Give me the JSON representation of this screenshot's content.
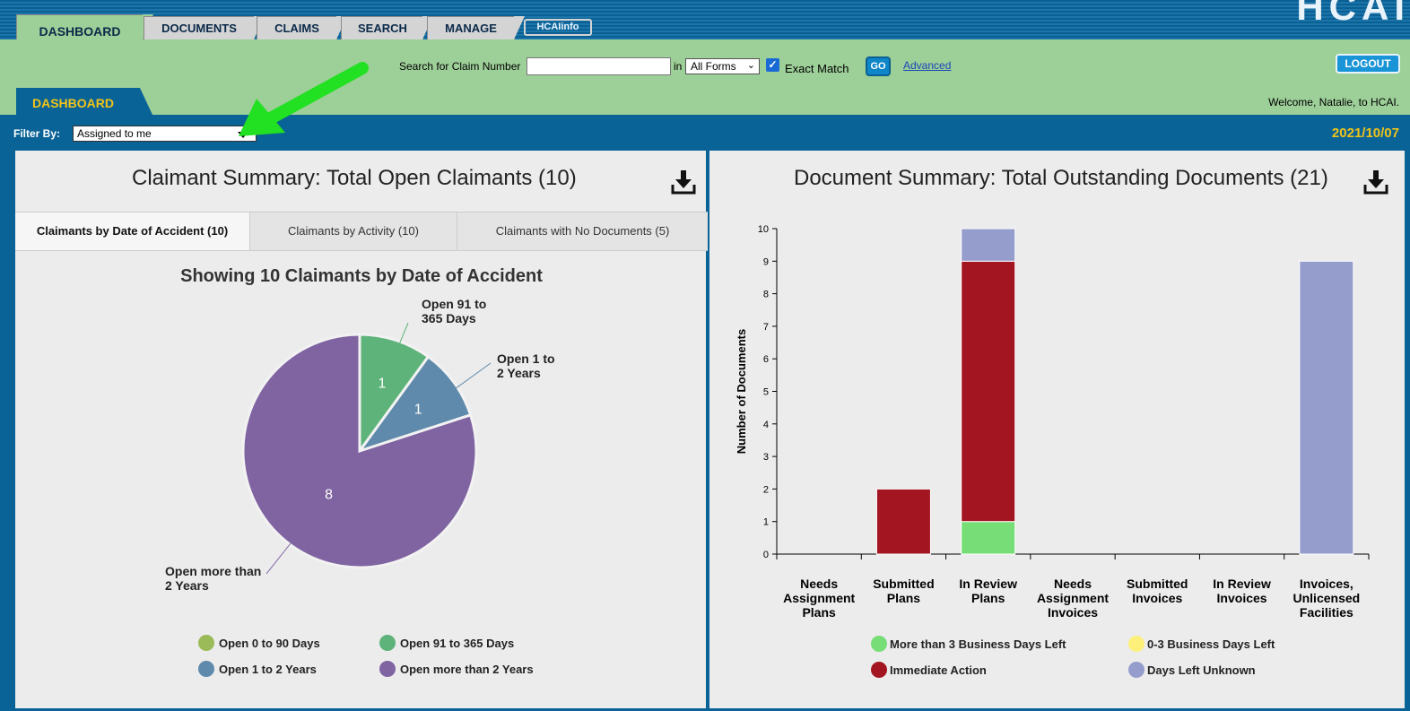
{
  "nav": {
    "tabs": [
      "DASHBOARD",
      "DOCUMENTS",
      "CLAIMS",
      "SEARCH",
      "MANAGE"
    ],
    "hcainfo": "HCAIinfo",
    "logo_text": "HCAI"
  },
  "search": {
    "label": "Search for Claim Number",
    "value": "",
    "in_label": "in",
    "forms_selected": "All Forms",
    "exact_match_label": "Exact Match",
    "exact_match_checked": true,
    "go_label": "GO",
    "advanced_label": "Advanced"
  },
  "header": {
    "logout_label": "LOGOUT",
    "subtab_label": "DASHBOARD",
    "welcome": "Welcome, Natalie, to HCAI."
  },
  "filter": {
    "label": "Filter By:",
    "selected": "Assigned to me",
    "date": "2021/10/07"
  },
  "claimant_panel": {
    "title": "Claimant Summary: Total Open Claimants (10)",
    "tabs": [
      "Claimants by Date of Accident (10)",
      "Claimants by Activity (10)",
      "Claimants with No Documents (5)"
    ],
    "active_tab": 0
  },
  "document_panel": {
    "title": "Document Summary: Total Outstanding Documents (21)"
  },
  "chart_data": [
    {
      "type": "pie",
      "title": "Showing 10 Claimants by Date of Accident",
      "slices": [
        {
          "label": "Open 91 to\n365 Days",
          "value": 1,
          "color": "#5eb37a"
        },
        {
          "label": "Open 1 to\n2 Years",
          "value": 1,
          "color": "#5f8aab"
        },
        {
          "label": "Open more than\n2 Years",
          "value": 8,
          "color": "#8064a2"
        }
      ],
      "legend": [
        {
          "label": "Open 0 to 90 Days",
          "color": "#9bbb59"
        },
        {
          "label": "Open 91 to 365 Days",
          "color": "#5eb37a"
        },
        {
          "label": "Open 1 to 2 Years",
          "color": "#5f8aab"
        },
        {
          "label": "Open more than 2 Years",
          "color": "#8064a2"
        }
      ],
      "legend_position": "bottom"
    },
    {
      "type": "bar",
      "stacked": true,
      "categories": [
        "Needs\nAssignment\nPlans",
        "Submitted\nPlans",
        "In Review\nPlans",
        "Needs\nAssignment\nInvoices",
        "Submitted\nInvoices",
        "In Review\nInvoices",
        "Invoices,\nUnlicensed\nFacilities"
      ],
      "series": [
        {
          "name": "More than 3 Business Days Left",
          "color": "#77dd77",
          "values": [
            0,
            0,
            1,
            0,
            0,
            0,
            0
          ]
        },
        {
          "name": "0-3 Business Days Left",
          "color": "#fdf07a",
          "values": [
            0,
            0,
            0,
            0,
            0,
            0,
            0
          ]
        },
        {
          "name": "Immediate Action",
          "color": "#a31621",
          "values": [
            0,
            2,
            8,
            0,
            0,
            0,
            0
          ]
        },
        {
          "name": "Days Left Unknown",
          "color": "#959dcc",
          "values": [
            0,
            0,
            1,
            0,
            0,
            0,
            9
          ]
        }
      ],
      "ylabel": "Number of Documents",
      "ylim": [
        0,
        10
      ],
      "yticks": [
        0,
        1,
        2,
        3,
        4,
        5,
        6,
        7,
        8,
        9,
        10
      ],
      "legend_position": "bottom"
    }
  ]
}
